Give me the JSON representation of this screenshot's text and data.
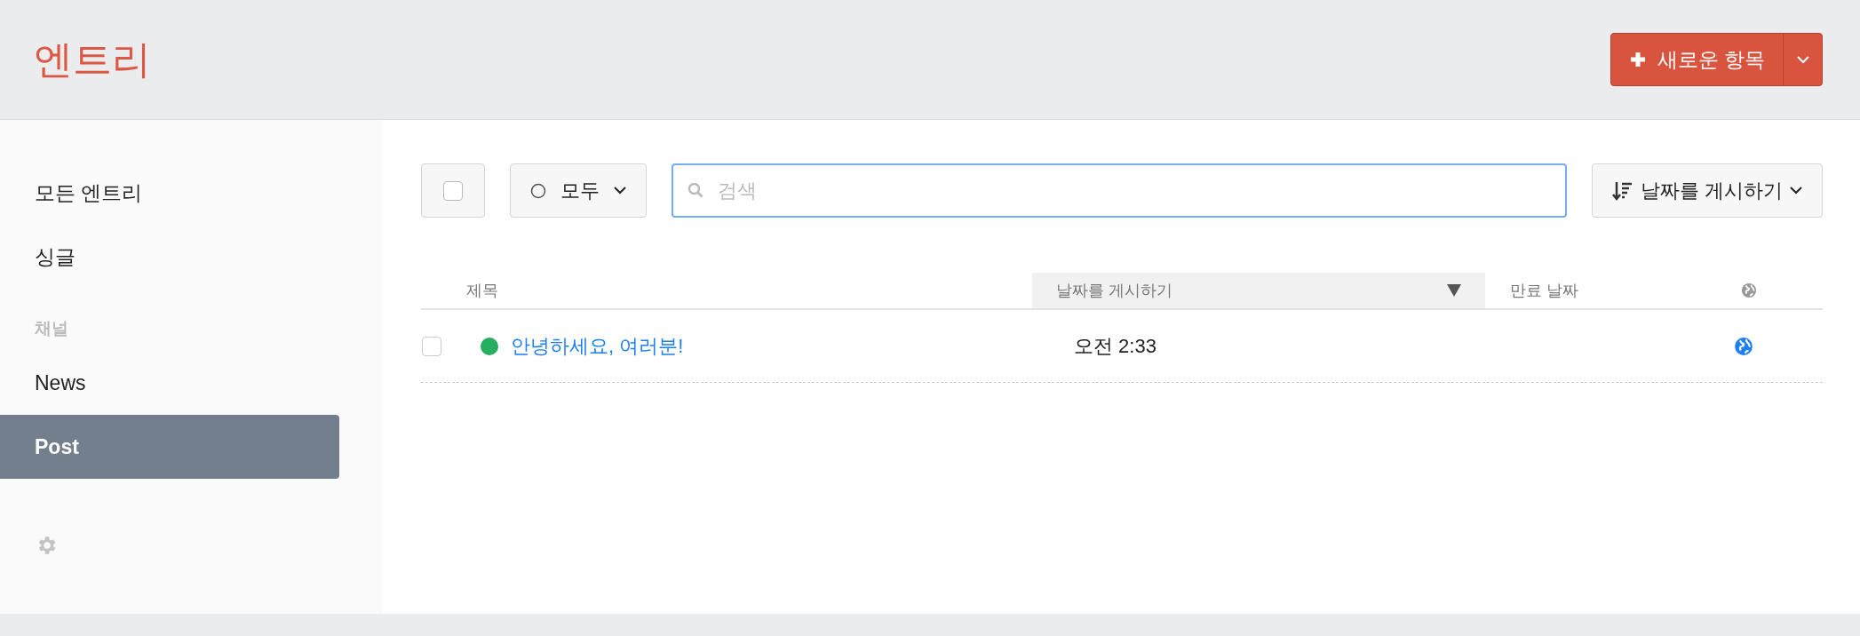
{
  "header": {
    "title": "엔트리",
    "new_button": "새로운 항목"
  },
  "sidebar": {
    "items": [
      {
        "label": "모든 엔트리",
        "selected": false
      },
      {
        "label": "싱글",
        "selected": false
      }
    ],
    "section": "채널",
    "channels": [
      {
        "label": "News",
        "selected": false
      },
      {
        "label": "Post",
        "selected": true
      }
    ]
  },
  "toolbar": {
    "select_all": {
      "checked": false
    },
    "status_filter": "모두",
    "search": {
      "placeholder": "검색"
    },
    "sort": "날짜를 게시하기"
  },
  "table": {
    "columns": [
      {
        "label": "제목",
        "sorted": false
      },
      {
        "label": "날짜를 게시하기",
        "sorted": true
      },
      {
        "label": "만료 날짜",
        "sorted": false
      }
    ],
    "rows": [
      {
        "checked": false,
        "color": "#27ae60",
        "title": "안녕하세요, 여러분!",
        "date": "오전 2:33"
      }
    ]
  }
}
